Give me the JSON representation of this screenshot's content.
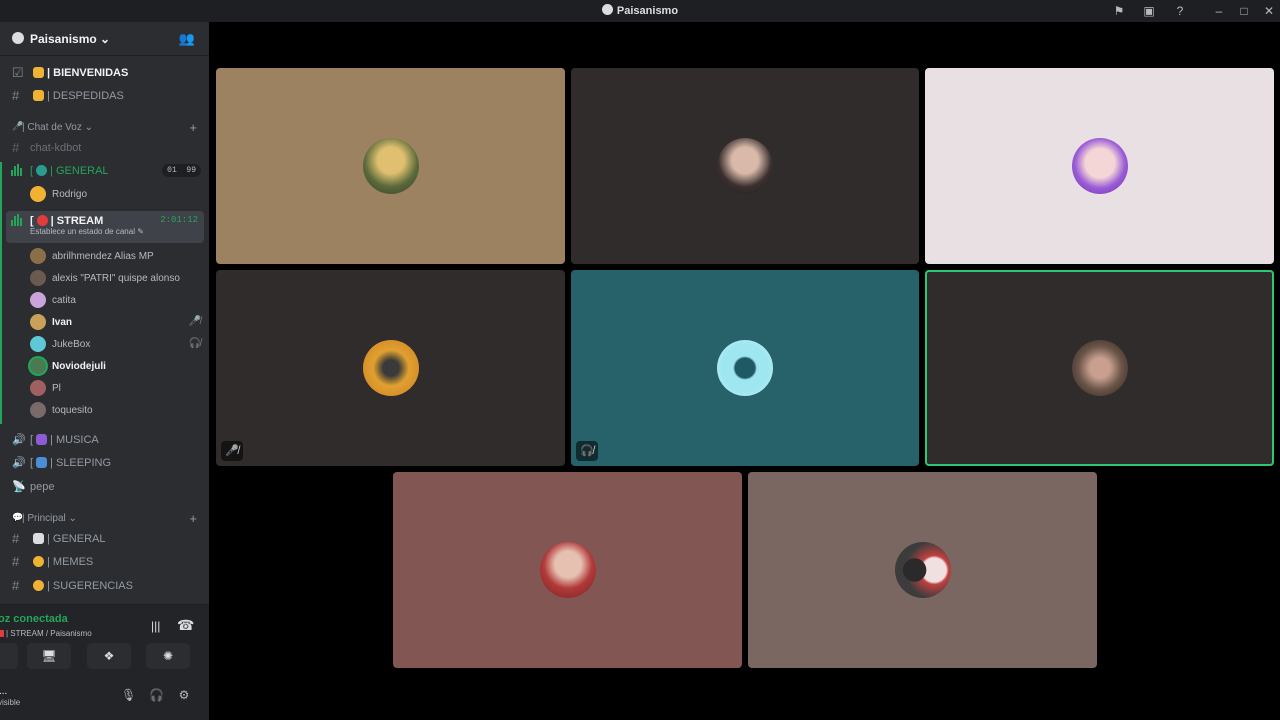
{
  "window": {
    "title": "Paisanismo"
  },
  "server": {
    "name": "Paisanismo"
  },
  "channels_top": [
    {
      "emoji_color": "#f0b232",
      "name": "| BIENVENIDAS",
      "prefix": "👋"
    },
    {
      "emoji_color": "#f0b232",
      "name": "| DESPEDIDAS",
      "prefix": "👋"
    }
  ],
  "category_voice": {
    "label": "| Chat de Voz"
  },
  "chat_kdbot": "chat-kdbot",
  "voice_general": {
    "name": "| GENERAL",
    "count_a": "01",
    "count_b": "99",
    "users": [
      "Rodrigo"
    ]
  },
  "voice_stream": {
    "name": "| STREAM",
    "timer": "2:01:12",
    "status": "Establece un estado de canal",
    "users": [
      {
        "name": "abrilhmendez Alias MP",
        "color": "#8b6f47",
        "bold": false,
        "icon": ""
      },
      {
        "name": "alexis \"PATRI\" quispe alonso",
        "color": "#6b5a50",
        "bold": false,
        "icon": ""
      },
      {
        "name": "catita",
        "color": "#c9a3d9",
        "bold": false,
        "icon": ""
      },
      {
        "name": "Ivan",
        "color": "#c9a05a",
        "bold": true,
        "icon": "🎤̸"
      },
      {
        "name": "JukeBox",
        "color": "#5ec8d8",
        "bold": false,
        "icon": "🎧̸"
      },
      {
        "name": "Noviodejuli",
        "color": "#4a7a52",
        "bold": true,
        "icon": ""
      },
      {
        "name": "Pl",
        "color": "#a06060",
        "bold": false,
        "icon": ""
      },
      {
        "name": "toquesito",
        "color": "#7a6a6a",
        "bold": false,
        "icon": ""
      }
    ]
  },
  "voice_musica": "| MUSICA",
  "voice_sleeping": "| SLEEPING",
  "voice_pepe": "pepe",
  "category_principal": {
    "label": "| Principal"
  },
  "channels_principal": [
    "| GENERAL",
    "| MEMES",
    "| SUGERENCIAS"
  ],
  "voice_connection": {
    "status": "oz conectada",
    "channel": "| STREAM / Paisanismo"
  },
  "user_panel": {
    "name": "...",
    "status": "visible"
  },
  "tiles": [
    {
      "bg": "#9c8261",
      "avatar": "#d4b060"
    },
    {
      "bg": "#312c2c",
      "avatar": "#7a6b6b"
    },
    {
      "bg": "#e9e0e3",
      "avatar": "#b592e0"
    },
    {
      "bg": "#312c2c",
      "avatar": "#e0a030",
      "badge": "mic-muted-icon"
    },
    {
      "bg": "#27626b",
      "avatar": "#9fe7f0",
      "badge": "deafened-icon"
    },
    {
      "bg": "#312c2c",
      "avatar": "#6b5548",
      "speaking": true
    },
    {
      "bg": "#815653",
      "avatar": "#a04545"
    },
    {
      "bg": "#7a6761",
      "avatar": "#3c3c3c"
    }
  ]
}
